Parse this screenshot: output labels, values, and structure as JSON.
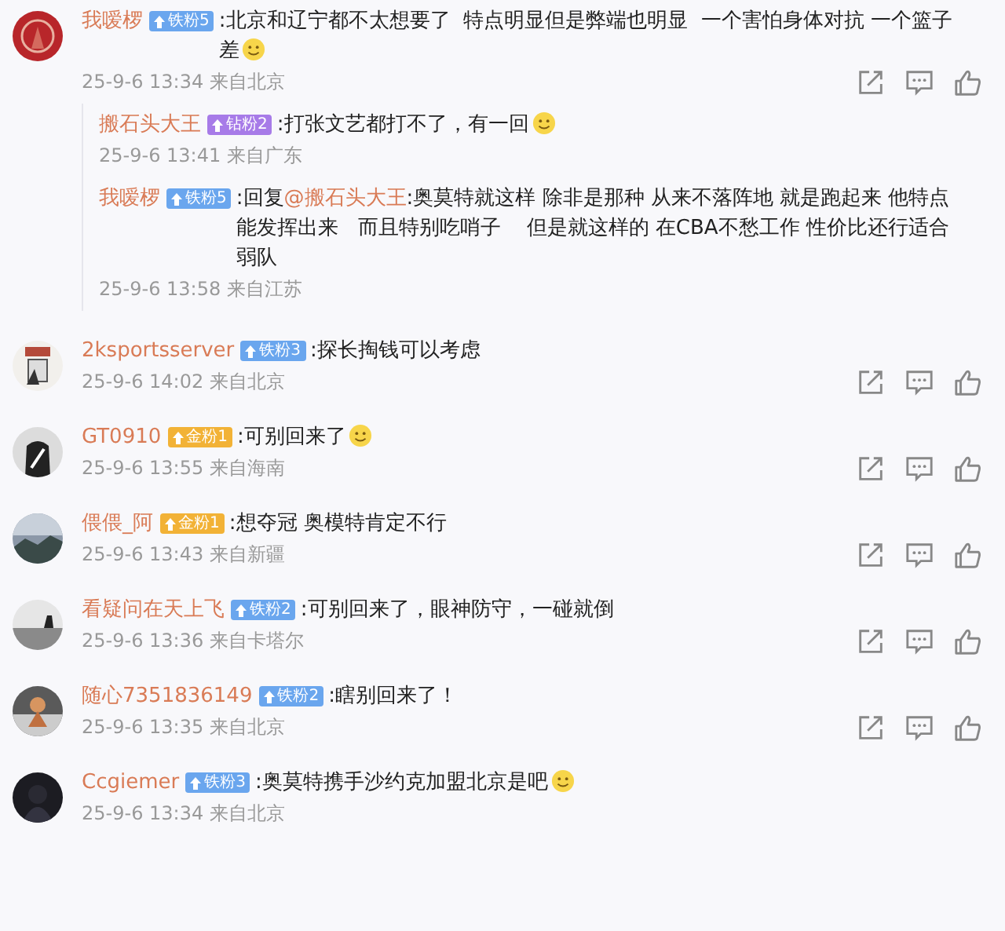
{
  "comments": [
    {
      "name": "我嗳椤",
      "badge": {
        "text": "铁粉5",
        "color": "#6aa6ee"
      },
      "text": ":北京和辽宁都不太想要了  特点明显但是弊端也明显  一个害怕身体对抗 一个篮子差",
      "emoji": true,
      "meta": "25-9-6 13:34 来自北京",
      "actions": true,
      "replies": [
        {
          "name": "搬石头大王",
          "badge": {
            "text": "钻粉2",
            "color": "#a77be8"
          },
          "text": ":打张文艺都打不了，有一回",
          "emoji": true,
          "meta": "25-9-6 13:41 来自广东"
        },
        {
          "name": "我嗳椤",
          "badge": {
            "text": "铁粉5",
            "color": "#6aa6ee"
          },
          "reply_prefix": ":回复",
          "mention": "@搬石头大王",
          "text": ":奥莫特就这样 除非是那种 从来不落阵地 就是跑起来 他特点能发挥出来   而且特别吃哨子    但是就这样的 在CBA不愁工作 性价比还行适合弱队",
          "emoji": false,
          "meta": "25-9-6 13:58 来自江苏"
        }
      ]
    },
    {
      "name": "2ksportsserver",
      "badge": {
        "text": "铁粉3",
        "color": "#6aa6ee"
      },
      "text": ":探长掏钱可以考虑",
      "emoji": false,
      "meta": "25-9-6 14:02 来自北京",
      "actions": true
    },
    {
      "name": "GT0910",
      "badge": {
        "text": "金粉1",
        "color": "#f2b236"
      },
      "text": ":可别回来了",
      "emoji": true,
      "meta": "25-9-6 13:55 来自海南",
      "actions": true
    },
    {
      "name": "偎偎_阿",
      "badge": {
        "text": "金粉1",
        "color": "#f2b236"
      },
      "text": ":想夺冠 奥模特肯定不行",
      "emoji": false,
      "meta": "25-9-6 13:43 来自新疆",
      "actions": true
    },
    {
      "name": "看疑问在天上飞",
      "badge": {
        "text": "铁粉2",
        "color": "#6aa6ee"
      },
      "text": ":可别回来了，眼神防守，一碰就倒",
      "emoji": false,
      "meta": "25-9-6 13:36 来自卡塔尔",
      "actions": true
    },
    {
      "name": "随心7351836149",
      "badge": {
        "text": "铁粉2",
        "color": "#6aa6ee"
      },
      "text": ":瞎别回来了！",
      "emoji": false,
      "meta": "25-9-6 13:35 来自北京",
      "actions": true
    },
    {
      "name": "Ccgiemer",
      "badge": {
        "text": "铁粉3",
        "color": "#6aa6ee"
      },
      "text": ":奥莫特携手沙约克加盟北京是吧",
      "emoji": true,
      "meta": "25-9-6 13:34 来自北京",
      "actions": false
    }
  ]
}
